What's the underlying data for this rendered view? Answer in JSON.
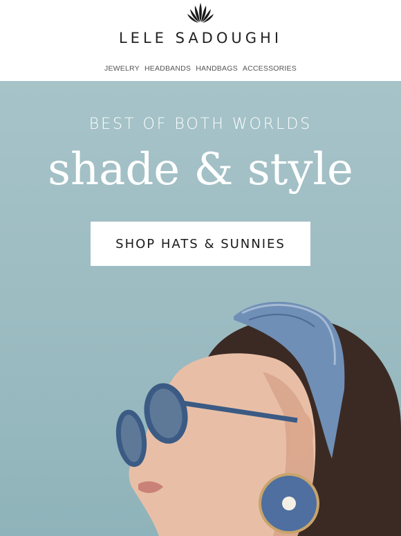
{
  "brand": {
    "name": "LELE SADOUGHI",
    "logo_icon": "shell-fan-icon"
  },
  "nav": {
    "items": [
      "JEWELRY",
      "HEADBANDS",
      "HANDBAGS",
      "ACCESSORIES"
    ]
  },
  "hero": {
    "eyebrow": "BEST OF BOTH WORLDS",
    "headline": "shade & style",
    "cta_label": "SHOP HATS & SUNNIES",
    "background_color": "#9dbdc3",
    "image_alt_desc": "model-with-sunglasses-and-headband"
  }
}
